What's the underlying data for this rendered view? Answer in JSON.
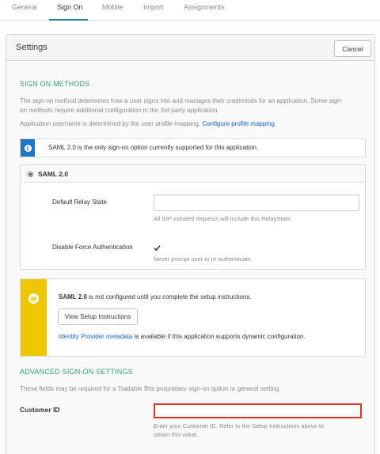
{
  "tabs": [
    {
      "label": "General"
    },
    {
      "label": "Sign On"
    },
    {
      "label": "Mobile"
    },
    {
      "label": "Import"
    },
    {
      "label": "Assignments"
    }
  ],
  "active_tab": "Sign On",
  "panel": {
    "title": "Settings",
    "cancel_label": "Cancel"
  },
  "sign_on_methods": {
    "heading": "SIGN ON METHODS",
    "description_line1": "The sign-on method determines how a user signs into and manages their credentials for an application. Some sign-",
    "description_line2": "on methods require additional configuration in the 3rd party application.",
    "username_text": "Application username is determined by the user profile mapping.",
    "profile_link": "Configure profile mapping"
  },
  "info_notice": {
    "icon": "info-icon",
    "text": "SAML 2.0 is the only sign-on option currently supported for this application."
  },
  "saml": {
    "option_label": "SAML 2.0",
    "relay_label": "Default Relay State",
    "relay_value": "",
    "relay_hint": "All IDP-initiated requests will include this RelayState.",
    "force_auth_label": "Disable Force Authentication",
    "force_auth_checked": true,
    "force_auth_hint": "Never prompt user to re-authenticate."
  },
  "setup_warning": {
    "icon": "list-icon",
    "bold": "SAML 2.0",
    "text": " is not configured until you complete the setup instructions.",
    "button_label": "View Setup Instructions",
    "metadata_link": "Identity Provider metadata",
    "metadata_text": " is available if this application supports dynamic configuration."
  },
  "advanced": {
    "heading": "ADVANCED SIGN-ON SETTINGS",
    "description": "These fields may be required for a Tradable Bits proprietary sign-on option or general setting.",
    "customer_id_label": "Customer ID",
    "customer_id_value": "",
    "customer_id_hint_line1": "Enter your Customer ID. Refer to the Setup Instructions above to",
    "customer_id_hint_line2": "obtain this value."
  },
  "colors": {
    "accent_green": "#2f9e6c",
    "link_blue": "#1862c7",
    "info_blue": "#1f76c2",
    "warning_yellow": "#edc700",
    "highlight_red": "#e2331f",
    "tab_underline": "#1a7e9f"
  }
}
